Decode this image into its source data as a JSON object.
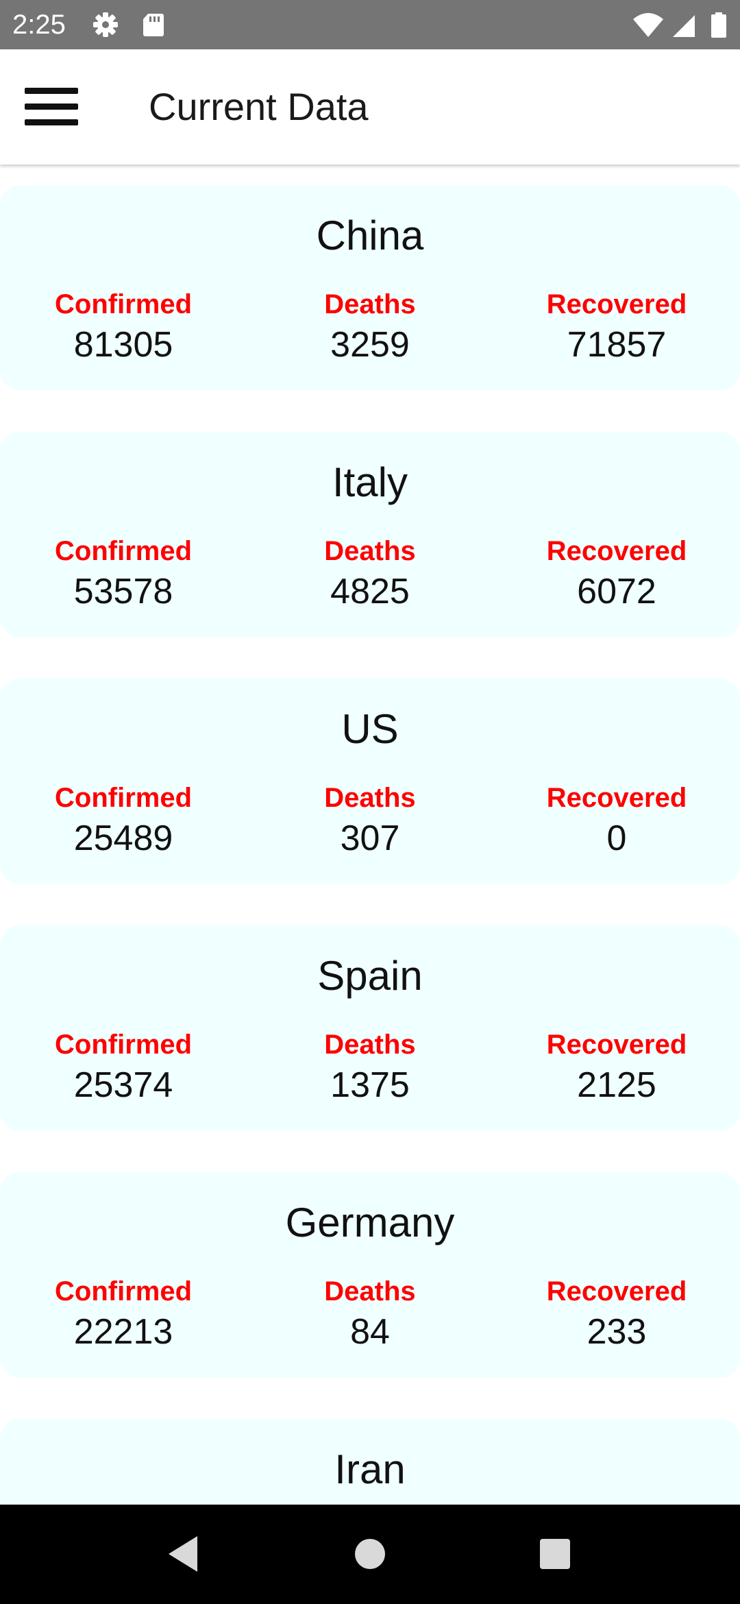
{
  "status_bar": {
    "time": "2:25",
    "left_icons": [
      "settings-icon",
      "sd-card-icon"
    ],
    "right_icons": [
      "wifi-icon",
      "signal-icon",
      "battery-icon"
    ]
  },
  "app_bar": {
    "menu_icon": "hamburger-menu-icon",
    "title": "Current Data"
  },
  "countries": [
    {
      "name": "China",
      "confirmed_label": "Confirmed",
      "confirmed": "81305",
      "deaths_label": "Deaths",
      "deaths": "3259",
      "recovered_label": "Recovered",
      "recovered": "71857"
    },
    {
      "name": "Italy",
      "confirmed_label": "Confirmed",
      "confirmed": "53578",
      "deaths_label": "Deaths",
      "deaths": "4825",
      "recovered_label": "Recovered",
      "recovered": "6072"
    },
    {
      "name": "US",
      "confirmed_label": "Confirmed",
      "confirmed": "25489",
      "deaths_label": "Deaths",
      "deaths": "307",
      "recovered_label": "Recovered",
      "recovered": "0"
    },
    {
      "name": "Spain",
      "confirmed_label": "Confirmed",
      "confirmed": "25374",
      "deaths_label": "Deaths",
      "deaths": "1375",
      "recovered_label": "Recovered",
      "recovered": "2125"
    },
    {
      "name": "Germany",
      "confirmed_label": "Confirmed",
      "confirmed": "22213",
      "deaths_label": "Deaths",
      "deaths": "84",
      "recovered_label": "Recovered",
      "recovered": "233"
    },
    {
      "name": "Iran"
    }
  ],
  "colors": {
    "status_bar": "#757575",
    "card_background": "#f0ffff",
    "stat_label": "#ff0000",
    "nav_bar": "#000000"
  },
  "nav_bar": {
    "icons": [
      "back-icon",
      "home-icon",
      "recents-icon"
    ]
  }
}
